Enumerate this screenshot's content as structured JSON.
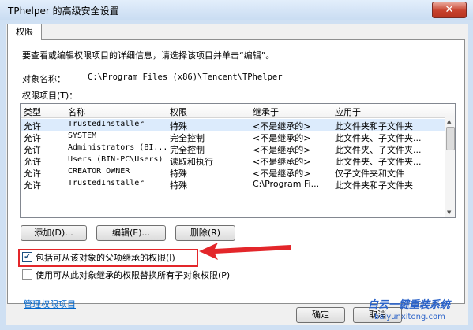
{
  "window": {
    "title": "TPhelper 的高级安全设置",
    "close": "✕"
  },
  "tab": "权限",
  "instructions": "要查看或编辑权限项目的详细信息，请选择该项目并单击“编辑”。",
  "object_name_label": "对象名称：",
  "object_name_value": "C:\\Program Files (x86)\\Tencent\\TPhelper",
  "entries_label": "权限项目(T)：",
  "columns": [
    "类型",
    "名称",
    "权限",
    "继承于",
    "应用于"
  ],
  "rows": [
    [
      "允许",
      "TrustedInstaller",
      "特殊",
      "<不是继承的>",
      "此文件夹和子文件夹"
    ],
    [
      "允许",
      "SYSTEM",
      "完全控制",
      "<不是继承的>",
      "此文件夹、子文件夹..."
    ],
    [
      "允许",
      "Administrators (BI...",
      "完全控制",
      "<不是继承的>",
      "此文件夹、子文件夹..."
    ],
    [
      "允许",
      "Users (BIN-PC\\Users)",
      "读取和执行",
      "<不是继承的>",
      "此文件夹、子文件夹..."
    ],
    [
      "允许",
      "CREATOR OWNER",
      "特殊",
      "<不是继承的>",
      "仅子文件夹和文件"
    ],
    [
      "允许",
      "TrustedInstaller",
      "特殊",
      "C:\\Program Fi...",
      "此文件夹和子文件夹"
    ]
  ],
  "buttons": {
    "add": "添加(D)...",
    "edit": "编辑(E)...",
    "delete": "删除(R)"
  },
  "checkbox_inherit": {
    "label": "包括可从该对象的父项继承的权限(I)",
    "checked": true
  },
  "checkbox_replace": {
    "label": "使用可从此对象继承的权限替换所有子对象权限(P)",
    "checked": false
  },
  "manage_link": "管理权限项目",
  "footer": {
    "ok": "确定",
    "cancel": "取消"
  },
  "watermark": {
    "text": "白云一键重装系统",
    "url": "baiyunxitong.com"
  },
  "colors": {
    "highlight_box": "#e3262a",
    "link": "#0066cc",
    "selected_row": "#dcebfc"
  }
}
